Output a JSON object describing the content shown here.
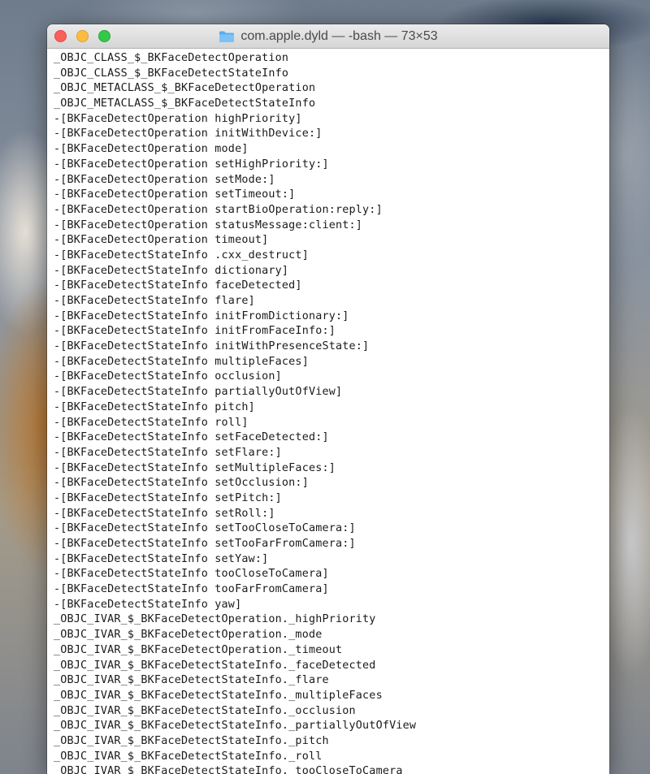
{
  "window": {
    "title": "com.apple.dyld — -bash — 73×53"
  },
  "icons": {
    "folder": "folder-icon",
    "close": "close-button",
    "minimize": "minimize-button",
    "zoom": "zoom-button"
  },
  "colors": {
    "close": "#fc605c",
    "minimize": "#fdbc40",
    "zoom": "#34c84a",
    "folder": "#5aaef0",
    "terminal_bg": "#ffffff",
    "terminal_fg": "#1a1a1a"
  },
  "terminal": {
    "lines": [
      "_OBJC_CLASS_$_BKFaceDetectOperation",
      "_OBJC_CLASS_$_BKFaceDetectStateInfo",
      "_OBJC_METACLASS_$_BKFaceDetectOperation",
      "_OBJC_METACLASS_$_BKFaceDetectStateInfo",
      "-[BKFaceDetectOperation highPriority]",
      "-[BKFaceDetectOperation initWithDevice:]",
      "-[BKFaceDetectOperation mode]",
      "-[BKFaceDetectOperation setHighPriority:]",
      "-[BKFaceDetectOperation setMode:]",
      "-[BKFaceDetectOperation setTimeout:]",
      "-[BKFaceDetectOperation startBioOperation:reply:]",
      "-[BKFaceDetectOperation statusMessage:client:]",
      "-[BKFaceDetectOperation timeout]",
      "-[BKFaceDetectStateInfo .cxx_destruct]",
      "-[BKFaceDetectStateInfo dictionary]",
      "-[BKFaceDetectStateInfo faceDetected]",
      "-[BKFaceDetectStateInfo flare]",
      "-[BKFaceDetectStateInfo initFromDictionary:]",
      "-[BKFaceDetectStateInfo initFromFaceInfo:]",
      "-[BKFaceDetectStateInfo initWithPresenceState:]",
      "-[BKFaceDetectStateInfo multipleFaces]",
      "-[BKFaceDetectStateInfo occlusion]",
      "-[BKFaceDetectStateInfo partiallyOutOfView]",
      "-[BKFaceDetectStateInfo pitch]",
      "-[BKFaceDetectStateInfo roll]",
      "-[BKFaceDetectStateInfo setFaceDetected:]",
      "-[BKFaceDetectStateInfo setFlare:]",
      "-[BKFaceDetectStateInfo setMultipleFaces:]",
      "-[BKFaceDetectStateInfo setOcclusion:]",
      "-[BKFaceDetectStateInfo setPitch:]",
      "-[BKFaceDetectStateInfo setRoll:]",
      "-[BKFaceDetectStateInfo setTooCloseToCamera:]",
      "-[BKFaceDetectStateInfo setTooFarFromCamera:]",
      "-[BKFaceDetectStateInfo setYaw:]",
      "-[BKFaceDetectStateInfo tooCloseToCamera]",
      "-[BKFaceDetectStateInfo tooFarFromCamera]",
      "-[BKFaceDetectStateInfo yaw]",
      "_OBJC_IVAR_$_BKFaceDetectOperation._highPriority",
      "_OBJC_IVAR_$_BKFaceDetectOperation._mode",
      "_OBJC_IVAR_$_BKFaceDetectOperation._timeout",
      "_OBJC_IVAR_$_BKFaceDetectStateInfo._faceDetected",
      "_OBJC_IVAR_$_BKFaceDetectStateInfo._flare",
      "_OBJC_IVAR_$_BKFaceDetectStateInfo._multipleFaces",
      "_OBJC_IVAR_$_BKFaceDetectStateInfo._occlusion",
      "_OBJC_IVAR_$_BKFaceDetectStateInfo._partiallyOutOfView",
      "_OBJC_IVAR_$_BKFaceDetectStateInfo._pitch",
      "_OBJC_IVAR_$_BKFaceDetectStateInfo._roll",
      "_OBJC_IVAR_$_BKFaceDetectStateInfo._tooCloseToCamera"
    ]
  }
}
